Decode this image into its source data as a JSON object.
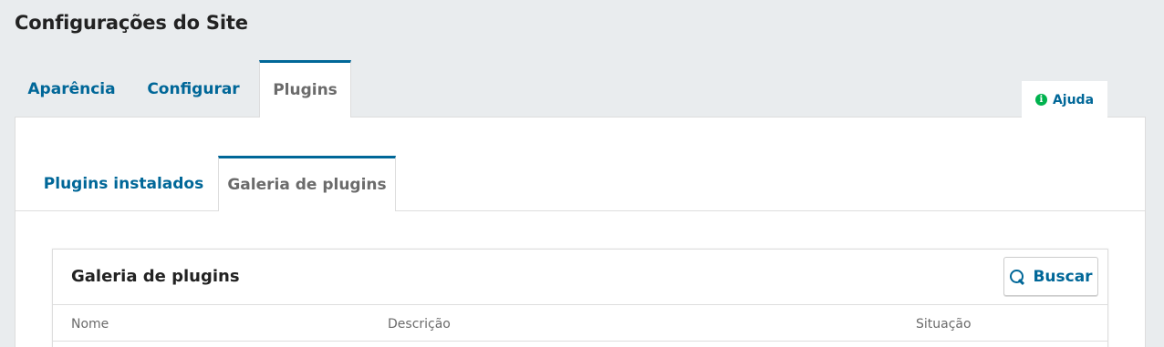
{
  "page": {
    "title": "Configurações do Site"
  },
  "top_tabs": [
    {
      "label": "Aparência",
      "active": false
    },
    {
      "label": "Configurar",
      "active": false
    },
    {
      "label": "Plugins",
      "active": true
    }
  ],
  "help": {
    "label": "Ajuda",
    "icon": "info-icon"
  },
  "sub_tabs": [
    {
      "label": "Plugins instalados",
      "active": false
    },
    {
      "label": "Galeria de plugins",
      "active": true
    }
  ],
  "gallery": {
    "title": "Galeria de plugins",
    "search_label": "Buscar",
    "columns": [
      "Nome",
      "Descrição",
      "Situação"
    ]
  },
  "colors": {
    "accent": "#006798",
    "help_icon": "#00b24e",
    "background": "#e9ecee"
  }
}
